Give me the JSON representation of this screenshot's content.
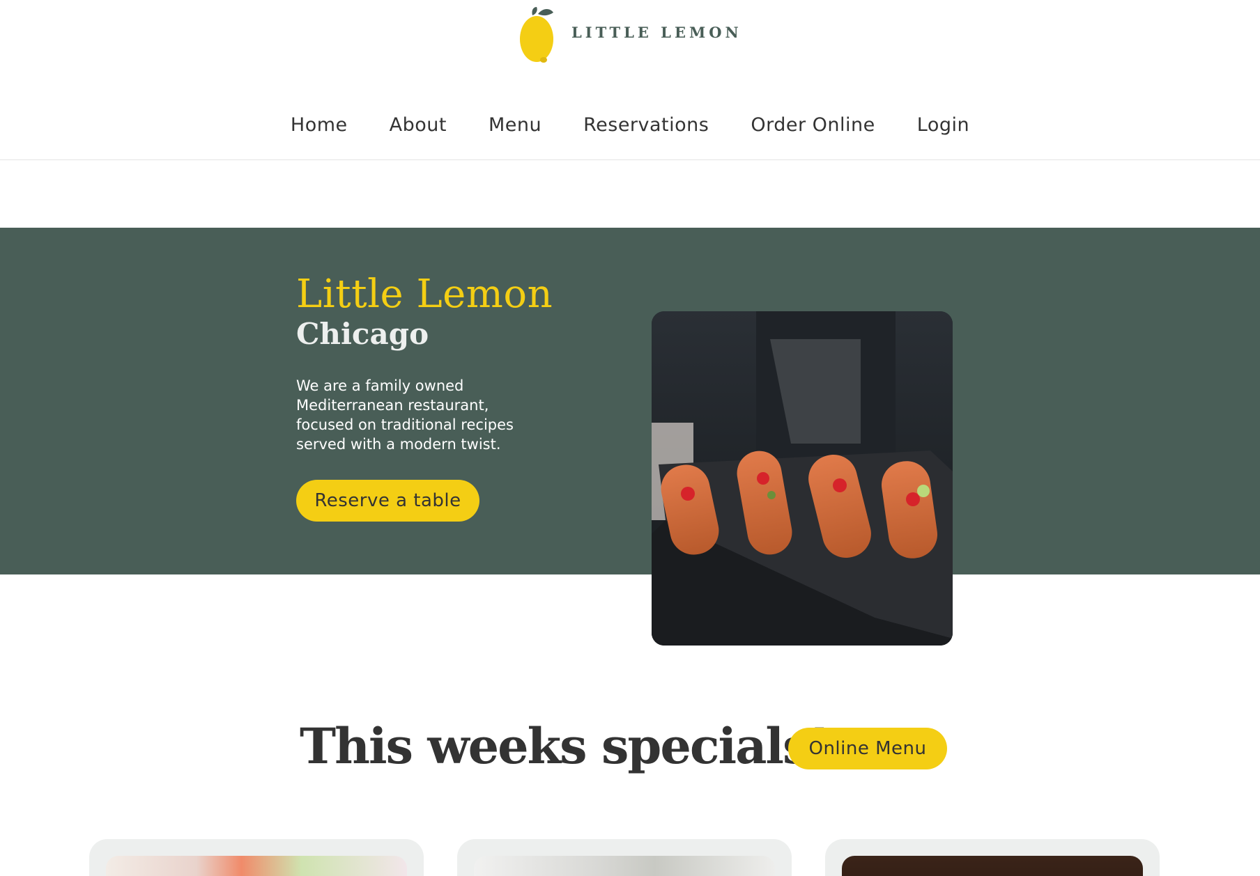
{
  "brand": {
    "logo_text": "LITTLE LEMON",
    "colors": {
      "primary_green": "#495e57",
      "primary_yellow": "#f4ce14",
      "highlight_light": "#edefee",
      "text_dark": "#333333"
    }
  },
  "nav": {
    "items": [
      {
        "label": "Home"
      },
      {
        "label": "About"
      },
      {
        "label": "Menu"
      },
      {
        "label": "Reservations"
      },
      {
        "label": "Order Online"
      },
      {
        "label": "Login"
      }
    ]
  },
  "hero": {
    "title": "Little Lemon",
    "subtitle": "Chicago",
    "description": "We are a family owned Mediterranean restaurant, focused on traditional recipes served with a modern twist.",
    "cta_label": "Reserve a table",
    "image_icon": "restaurant-food-photo"
  },
  "specials": {
    "title": "This weeks specials!",
    "menu_button_label": "Online Menu",
    "cards": [
      {
        "image_icon": "greek-salad-photo"
      },
      {
        "image_icon": "bruschetta-photo"
      },
      {
        "image_icon": "lemon-dessert-photo"
      }
    ]
  }
}
